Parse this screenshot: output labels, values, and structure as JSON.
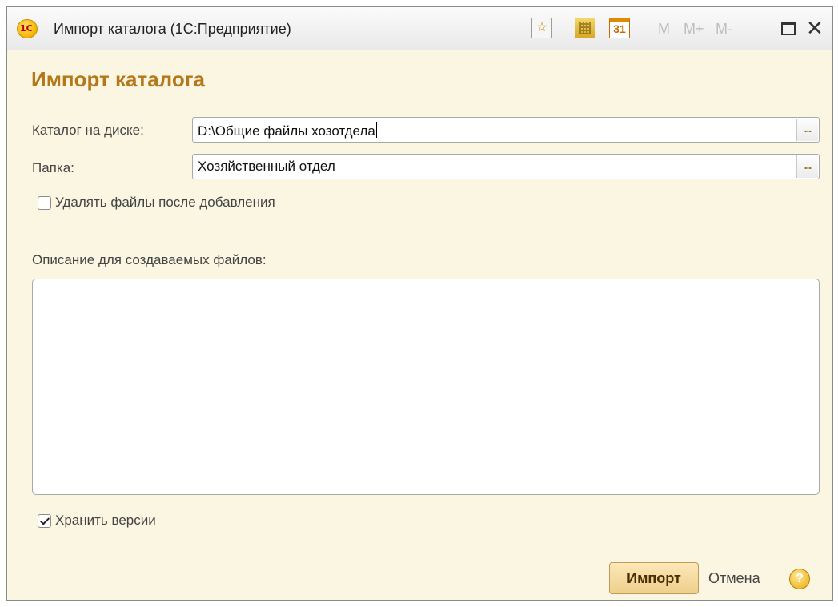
{
  "window": {
    "logo_text": "1С",
    "title": "Импорт каталога  (1С:Предприятие)",
    "toolbar": {
      "favorites_icon": "star-icon",
      "calculator_icon": "calculator-icon",
      "calendar_icon": "calendar-icon",
      "calendar_day": "31",
      "mem_m": "M",
      "mem_plus": "M+",
      "mem_minus": "M-"
    }
  },
  "form": {
    "title": "Импорт каталога",
    "catalog": {
      "label": "Каталог на диске:",
      "value": "D:\\Общие файлы хозотдела",
      "button": "..."
    },
    "folder": {
      "label": "Папка:",
      "value": "Хозяйственный отдел",
      "button": "..."
    },
    "delete_files": {
      "label": "Удалять файлы после добавления",
      "checked": false
    },
    "description": {
      "label": "Описание для создаваемых файлов:",
      "value": ""
    },
    "keep_versions": {
      "label": "Хранить версии",
      "checked": true
    }
  },
  "footer": {
    "import_label": "Импорт",
    "cancel_label": "Отмена",
    "help_label": "?"
  },
  "colors": {
    "form_title": "#b4781a",
    "background": "#fbf6e2",
    "import_button": "#efcf8c"
  }
}
